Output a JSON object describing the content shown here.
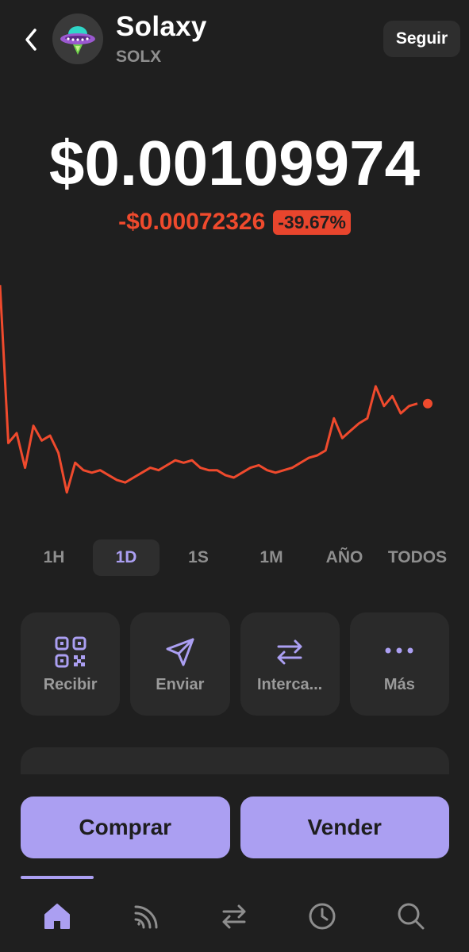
{
  "header": {
    "token_name": "Solaxy",
    "token_symbol": "SOLX",
    "follow_label": "Seguir"
  },
  "price": {
    "value": "$0.00109974",
    "change_amount": "-$0.00072326",
    "change_percent": "-39.67%"
  },
  "chart_data": {
    "type": "line",
    "color": "#ef4a2d",
    "series": [
      {
        "values": [
          0.00182,
          0.00118,
          0.00122,
          0.00108,
          0.00125,
          0.00119,
          0.00121,
          0.00114,
          0.00098,
          0.0011,
          0.00107,
          0.00106,
          0.00107,
          0.00105,
          0.00103,
          0.00102,
          0.00104,
          0.00106,
          0.00108,
          0.00107,
          0.00109,
          0.00111,
          0.0011,
          0.00111,
          0.00108,
          0.00107,
          0.00107,
          0.00105,
          0.00104,
          0.00106,
          0.00108,
          0.00109,
          0.00107,
          0.00106,
          0.00107,
          0.00108,
          0.0011,
          0.00112,
          0.00113,
          0.00115,
          0.00128,
          0.0012,
          0.00123,
          0.00126,
          0.00128,
          0.00141,
          0.00133,
          0.00137,
          0.0013,
          0.00133,
          0.00134
        ]
      }
    ],
    "last_value": 0.00109974
  },
  "ranges": [
    "1H",
    "1D",
    "1S",
    "1M",
    "AÑO",
    "TODOS"
  ],
  "active_range": "1D",
  "actions": {
    "receive": "Recibir",
    "send": "Enviar",
    "swap": "Interca...",
    "more": "Más"
  },
  "buttons": {
    "buy": "Comprar",
    "sell": "Vender"
  },
  "colors": {
    "background": "#1f1f1f",
    "accent": "#ab9ff2",
    "negative": "#ef4a2d"
  },
  "tabs": [
    "home-icon",
    "feed-icon",
    "swap-icon",
    "history-icon",
    "search-icon"
  ]
}
